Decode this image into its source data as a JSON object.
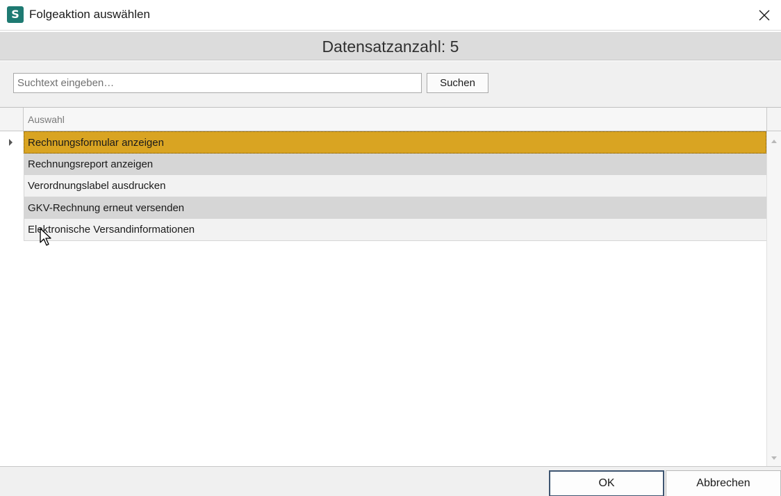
{
  "window": {
    "title": "Folgeaktion auswählen",
    "app_icon_letter": "S",
    "accent_color": "#1e7a72"
  },
  "summary": {
    "record_count_text": "Datensatzanzahl: 5"
  },
  "search": {
    "placeholder": "Suchtext eingeben…",
    "value": "",
    "button_label": "Suchen"
  },
  "grid": {
    "column_header": "Auswahl",
    "selected_color": "#d9a422",
    "rows": [
      {
        "label": "Rechnungsformular anzeigen",
        "selected": true
      },
      {
        "label": "Rechnungsreport anzeigen",
        "selected": false
      },
      {
        "label": "Verordnungslabel ausdrucken",
        "selected": false
      },
      {
        "label": "GKV-Rechnung erneut versenden",
        "selected": false
      },
      {
        "label": "Elektronische Versandinformationen",
        "selected": false
      }
    ]
  },
  "footer": {
    "ok_label": "OK",
    "cancel_label": "Abbrechen"
  },
  "icons": {
    "close": "close-icon",
    "row_indicator": "caret-right-icon",
    "scroll_up": "scroll-up-arrow-icon",
    "scroll_down": "scroll-down-arrow-icon",
    "cursor": "mouse-pointer-icon"
  }
}
